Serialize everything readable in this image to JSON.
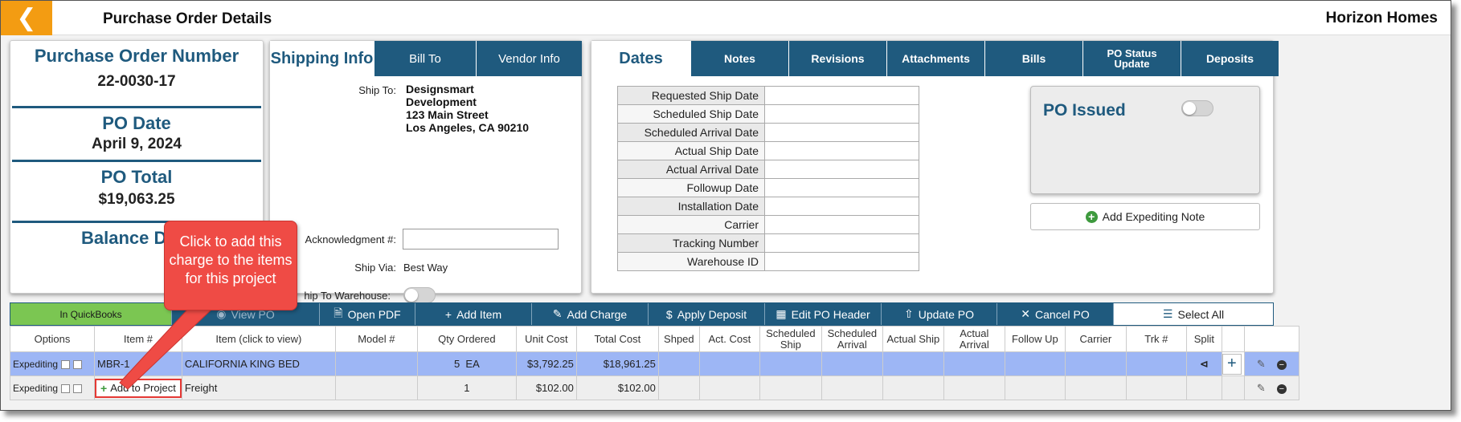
{
  "header": {
    "title": "Purchase Order Details",
    "company": "Horizon Homes"
  },
  "summary": {
    "po_number_label": "Purchase Order Number",
    "po_number": "22-0030-17",
    "po_date_label": "PO Date",
    "po_date": "April 9, 2024",
    "po_total_label": "PO Total",
    "po_total": "$19,063.25",
    "balance_label": "Balance D"
  },
  "shipping": {
    "tabs": [
      "Shipping Info",
      "Bill To",
      "Vendor Info"
    ],
    "ship_to_label": "Ship To:",
    "ship_to_lines": [
      "Designsmart",
      "Development",
      "123 Main Street",
      "Los Angeles, CA 90210"
    ],
    "ack_label": "Acknowledgment #:",
    "ack_value": "",
    "ship_via_label": "Ship Via:",
    "ship_via": "Best Way",
    "warehouse_label": "hip To Warehouse:"
  },
  "dates": {
    "tabs": [
      "Dates",
      "Notes",
      "Revisions",
      "Attachments",
      "Bills",
      "PO Status Update",
      "Deposits"
    ],
    "rows": [
      "Requested Ship Date",
      "Scheduled Ship Date",
      "Scheduled Arrival Date",
      "Actual Ship Date",
      "Actual Arrival Date",
      "Followup Date",
      "Installation Date",
      "Carrier",
      "Tracking Number",
      "Warehouse ID"
    ],
    "po_issued_label": "PO Issued",
    "add_note_label": "Add Expediting Note"
  },
  "toolbar": {
    "quickbooks": "In QuickBooks",
    "view_po": "View PO",
    "open_pdf": "Open PDF",
    "add_item": "Add Item",
    "add_charge": "Add Charge",
    "apply_deposit": "Apply Deposit",
    "edit_header": "Edit PO Header",
    "update_po": "Update PO",
    "cancel_po": "Cancel PO",
    "select_all": "Select All"
  },
  "items": {
    "columns": [
      "Options",
      "Item #",
      "Item (click to view)",
      "Model #",
      "Qty Ordered",
      "Unit Cost",
      "Total Cost",
      "Shped",
      "Act. Cost",
      "Scheduled Ship",
      "Scheduled Arrival",
      "Actual Ship",
      "Actual Arrival",
      "Follow Up",
      "Carrier",
      "Trk #",
      "Split"
    ],
    "rows": [
      {
        "option": "Expediting",
        "item_no": "MBR-1",
        "item": "CALIFORNIA KING BED",
        "qty": "5",
        "unit": "EA",
        "unit_cost": "$3,792.25",
        "total_cost": "$18,961.25"
      },
      {
        "option": "Expediting",
        "item_no": "Add to Project",
        "item": "Freight",
        "qty": "1",
        "unit": "",
        "unit_cost": "$102.00",
        "total_cost": "$102.00"
      }
    ]
  },
  "callout": {
    "text": "Click to add this charge to the items for this project",
    "color": "#ef4b45"
  },
  "colors": {
    "brand": "#1f5a7e",
    "back": "#f39c12",
    "quickbooks": "#7bc652",
    "row_highlight": "#9db6f5"
  }
}
